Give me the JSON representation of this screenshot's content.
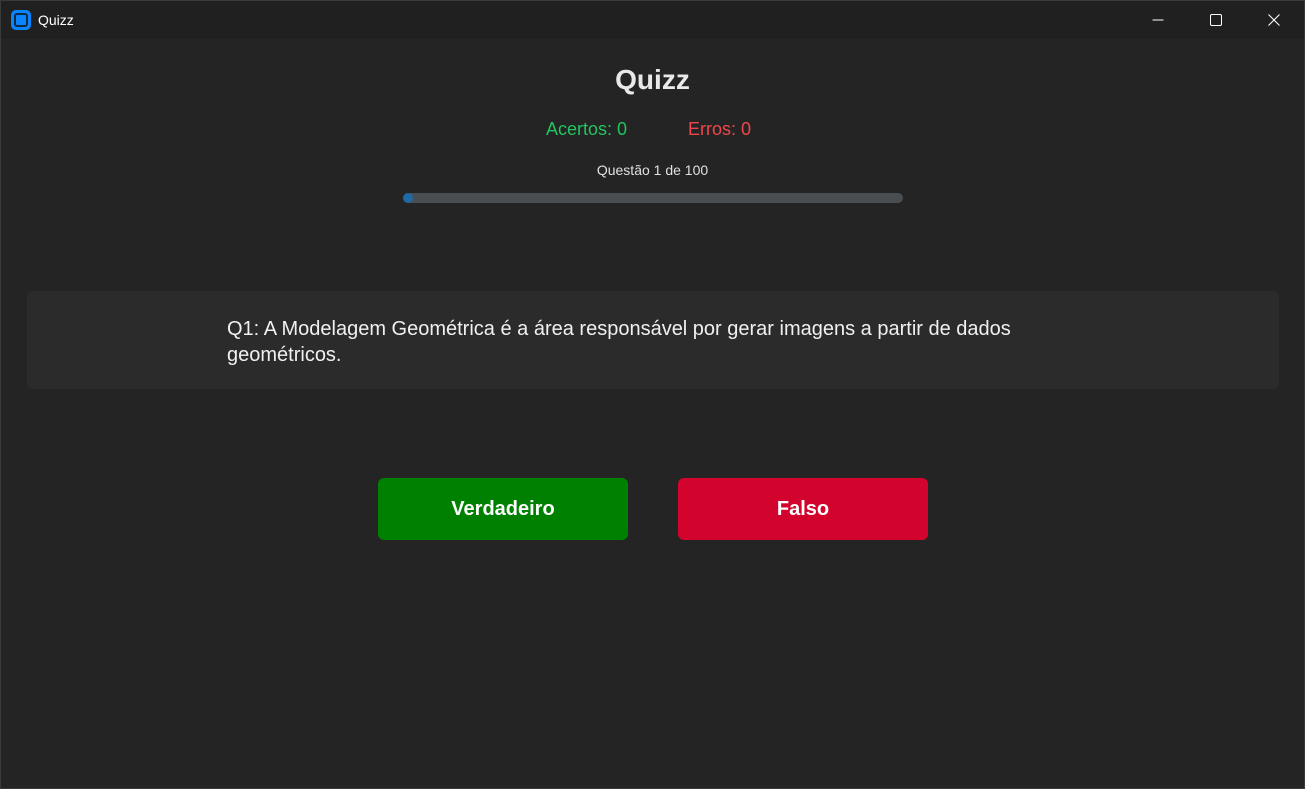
{
  "window": {
    "title": "Quizz",
    "icons": {
      "app": "app-icon",
      "minimize": "minimize-icon",
      "maximize": "maximize-icon",
      "close": "close-icon"
    }
  },
  "quiz": {
    "heading": "Quizz",
    "acertos": "Acertos: 0",
    "erros": "Erros: 0",
    "counter": "Questão 1 de 100",
    "progress_fraction": 0.01,
    "question": "Q1: A Modelagem Geométrica é a área responsável por gerar imagens a partir de dados geométricos."
  },
  "answers": {
    "true_label": "Verdadeiro",
    "false_label": "Falso"
  },
  "colors": {
    "background": "#242424",
    "acertos": "#22c55e",
    "erros": "#f0464c",
    "progress": "#1f6aa5",
    "true_button": "#008000",
    "false_button": "#d2042d"
  }
}
